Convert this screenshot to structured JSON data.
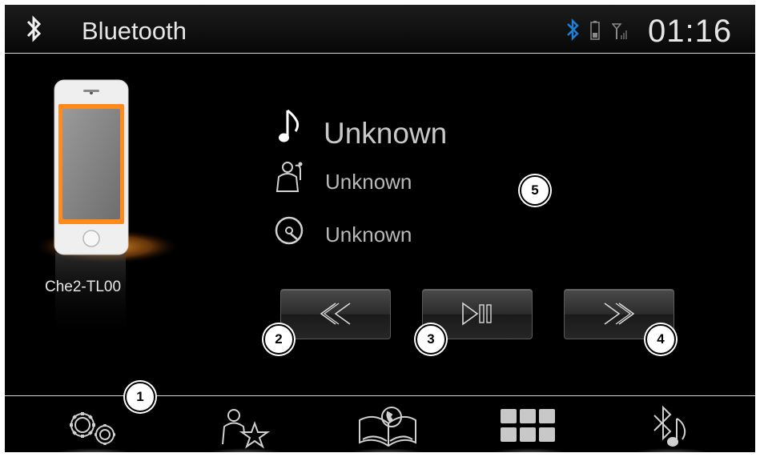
{
  "header": {
    "title": "Bluetooth",
    "clock": "01:16",
    "icons": [
      "bluetooth-icon",
      "bluetooth-status-icon",
      "battery-icon",
      "signal-icon"
    ]
  },
  "device": {
    "name": "Che2-TL00",
    "icon": "phone-icon"
  },
  "track": {
    "title": "Unknown",
    "artist": "Unknown",
    "album": "Unknown",
    "icons": [
      "music-note-icon",
      "artist-icon",
      "album-disc-icon"
    ]
  },
  "controls": {
    "icons": [
      "previous-icon",
      "play-pause-icon",
      "next-icon"
    ]
  },
  "tabs": {
    "icons": [
      "settings-icon",
      "favorites-icon",
      "phonebook-icon",
      "dialpad-icon",
      "bluetooth-music-icon"
    ]
  },
  "callouts": {
    "c1": "1",
    "c2": "2",
    "c3": "3",
    "c4": "4",
    "c5": "5"
  },
  "colors": {
    "background": "#000000",
    "text": "#e6e6e6",
    "bluetooth_blue": "#1e7fd6",
    "phone_glow": "#f07a1c"
  }
}
